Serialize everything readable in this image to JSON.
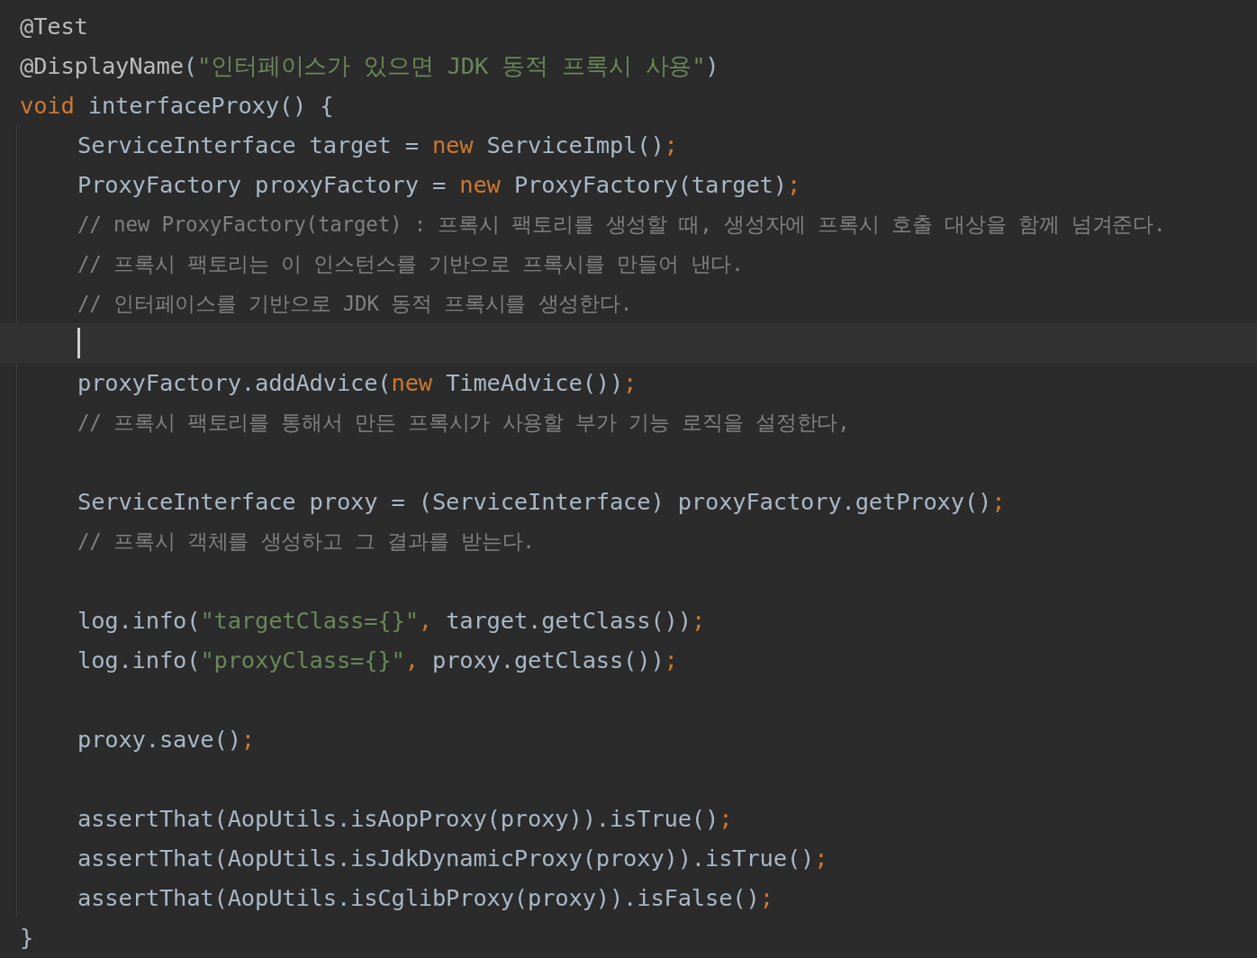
{
  "editor": {
    "lines": [
      {
        "kind": "code",
        "tokens": [
          {
            "kind": "annotation",
            "text": "@Test"
          }
        ]
      },
      {
        "kind": "code",
        "tokens": [
          {
            "kind": "annotation",
            "text": "@DisplayName"
          },
          {
            "kind": "plain",
            "text": "("
          },
          {
            "kind": "string",
            "text": "\"인터페이스가 있으면 JDK 동적 프록시 사용\""
          },
          {
            "kind": "plain",
            "text": ")"
          }
        ]
      },
      {
        "kind": "code",
        "tokens": [
          {
            "kind": "keyword",
            "text": "void "
          },
          {
            "kind": "plain",
            "text": "interfaceProxy() {"
          }
        ],
        "children": [
          {
            "kind": "code",
            "tokens": [
              {
                "kind": "plain",
                "text": "ServiceInterface target = "
              },
              {
                "kind": "keyword",
                "text": "new "
              },
              {
                "kind": "plain",
                "text": "ServiceImpl()"
              },
              {
                "kind": "keyword",
                "text": ";"
              }
            ]
          },
          {
            "kind": "code",
            "tokens": [
              {
                "kind": "plain",
                "text": "ProxyFactory proxyFactory = "
              },
              {
                "kind": "keyword",
                "text": "new "
              },
              {
                "kind": "plain",
                "text": "ProxyFactory(target)"
              },
              {
                "kind": "keyword",
                "text": ";"
              }
            ]
          },
          {
            "kind": "code",
            "tokens": [
              {
                "kind": "comment",
                "text": "// new ProxyFactory(target) : 프록시 팩토리를 생성할 때, 생성자에 프록시 호출 대상을 함께 넘겨준다."
              }
            ]
          },
          {
            "kind": "code",
            "tokens": [
              {
                "kind": "comment",
                "text": "// 프록시 팩토리는 이 인스턴스를 기반으로 프록시를 만들어 낸다."
              }
            ]
          },
          {
            "kind": "code",
            "tokens": [
              {
                "kind": "comment",
                "text": "// 인터페이스를 기반으로 JDK 동적 프록시를 생성한다."
              }
            ]
          },
          {
            "kind": "blank",
            "current": true
          },
          {
            "kind": "code",
            "tokens": [
              {
                "kind": "plain",
                "text": "proxyFactory.addAdvice("
              },
              {
                "kind": "keyword",
                "text": "new "
              },
              {
                "kind": "plain",
                "text": "TimeAdvice())"
              },
              {
                "kind": "keyword",
                "text": ";"
              }
            ]
          },
          {
            "kind": "code",
            "tokens": [
              {
                "kind": "comment",
                "text": "// 프록시 팩토리를 통해서 만든 프록시가 사용할 부가 기능 로직을 설정한다,"
              }
            ]
          },
          {
            "kind": "blank",
            "current": false
          },
          {
            "kind": "code",
            "tokens": [
              {
                "kind": "plain",
                "text": "ServiceInterface proxy = (ServiceInterface) proxyFactory.getProxy()"
              },
              {
                "kind": "keyword",
                "text": ";"
              }
            ]
          },
          {
            "kind": "code",
            "tokens": [
              {
                "kind": "comment",
                "text": "// 프록시 객체를 생성하고 그 결과를 받는다."
              }
            ]
          },
          {
            "kind": "blank",
            "current": false
          },
          {
            "kind": "code",
            "tokens": [
              {
                "kind": "plain",
                "text": "log.info("
              },
              {
                "kind": "string",
                "text": "\"targetClass={}\""
              },
              {
                "kind": "keyword",
                "text": ", "
              },
              {
                "kind": "plain",
                "text": "target.getClass())"
              },
              {
                "kind": "keyword",
                "text": ";"
              }
            ]
          },
          {
            "kind": "code",
            "tokens": [
              {
                "kind": "plain",
                "text": "log.info("
              },
              {
                "kind": "string",
                "text": "\"proxyClass={}\""
              },
              {
                "kind": "keyword",
                "text": ", "
              },
              {
                "kind": "plain",
                "text": "proxy.getClass())"
              },
              {
                "kind": "keyword",
                "text": ";"
              }
            ]
          },
          {
            "kind": "blank",
            "current": false
          },
          {
            "kind": "code",
            "tokens": [
              {
                "kind": "plain",
                "text": "proxy.save()"
              },
              {
                "kind": "keyword",
                "text": ";"
              }
            ]
          },
          {
            "kind": "blank",
            "current": false
          },
          {
            "kind": "code",
            "tokens": [
              {
                "kind": "plain",
                "text": "assertThat(AopUtils.isAopProxy(proxy)).isTrue()"
              },
              {
                "kind": "keyword",
                "text": ";"
              }
            ]
          },
          {
            "kind": "code",
            "tokens": [
              {
                "kind": "plain",
                "text": "assertThat(AopUtils.isJdkDynamicProxy(proxy)).isTrue()"
              },
              {
                "kind": "keyword",
                "text": ";"
              }
            ]
          },
          {
            "kind": "code",
            "tokens": [
              {
                "kind": "plain",
                "text": "assertThat(AopUtils.isCglibProxy(proxy)).isFalse()"
              },
              {
                "kind": "keyword",
                "text": ";"
              }
            ]
          }
        ]
      },
      {
        "kind": "code",
        "tokens": [
          {
            "kind": "plain",
            "text": "}"
          }
        ]
      }
    ]
  }
}
